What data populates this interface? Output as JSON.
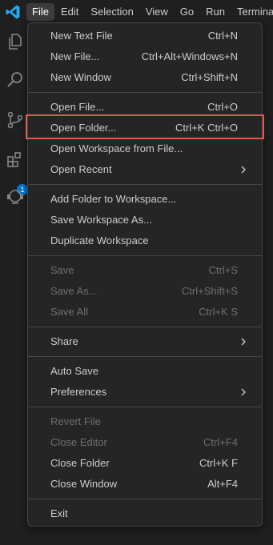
{
  "app": {
    "logo_icon": "vscode-logo-icon"
  },
  "menubar": {
    "items": [
      {
        "label": "File",
        "active": true
      },
      {
        "label": "Edit"
      },
      {
        "label": "Selection"
      },
      {
        "label": "View"
      },
      {
        "label": "Go"
      },
      {
        "label": "Run"
      },
      {
        "label": "Termina"
      }
    ]
  },
  "activity_bar": {
    "icons": [
      "explorer-icon",
      "search-icon",
      "source-control-icon",
      "extensions-icon",
      "remote-explorer-icon"
    ],
    "extensions_badge": "1"
  },
  "file_menu": {
    "new_text_file": {
      "label": "New Text File",
      "shortcut": "Ctrl+N"
    },
    "new_file": {
      "label": "New File...",
      "shortcut": "Ctrl+Alt+Windows+N"
    },
    "new_window": {
      "label": "New Window",
      "shortcut": "Ctrl+Shift+N"
    },
    "open_file": {
      "label": "Open File...",
      "shortcut": "Ctrl+O"
    },
    "open_folder": {
      "label": "Open Folder...",
      "shortcut": "Ctrl+K Ctrl+O"
    },
    "open_workspace": {
      "label": "Open Workspace from File..."
    },
    "open_recent": {
      "label": "Open Recent"
    },
    "add_folder": {
      "label": "Add Folder to Workspace..."
    },
    "save_workspace_as": {
      "label": "Save Workspace As..."
    },
    "duplicate_workspace": {
      "label": "Duplicate Workspace"
    },
    "save": {
      "label": "Save",
      "shortcut": "Ctrl+S",
      "disabled": true
    },
    "save_as": {
      "label": "Save As...",
      "shortcut": "Ctrl+Shift+S",
      "disabled": true
    },
    "save_all": {
      "label": "Save All",
      "shortcut": "Ctrl+K S",
      "disabled": true
    },
    "share": {
      "label": "Share"
    },
    "auto_save": {
      "label": "Auto Save"
    },
    "preferences": {
      "label": "Preferences"
    },
    "revert_file": {
      "label": "Revert File",
      "disabled": true
    },
    "close_editor": {
      "label": "Close Editor",
      "shortcut": "Ctrl+F4",
      "disabled": true
    },
    "close_folder": {
      "label": "Close Folder",
      "shortcut": "Ctrl+K F"
    },
    "close_window": {
      "label": "Close Window",
      "shortcut": "Alt+F4"
    },
    "exit": {
      "label": "Exit"
    }
  },
  "colors": {
    "highlight_border": "#e05a4e",
    "accent": "#0078d4",
    "logo": "#23a9f2"
  }
}
